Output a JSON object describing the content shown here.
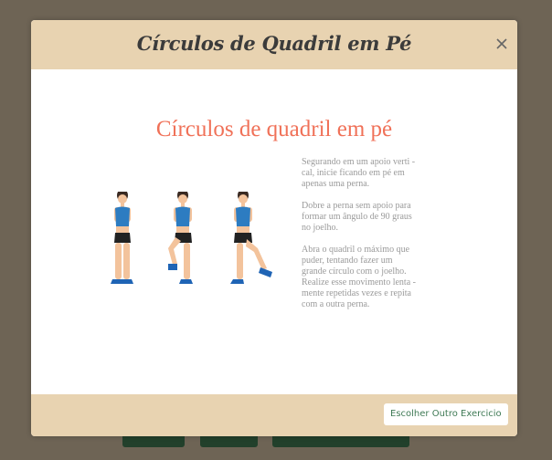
{
  "modal": {
    "title": "Círculos de Quadril em Pé",
    "close_label": "×",
    "close_icon": "close-icon"
  },
  "exercise": {
    "title": "Círculos de quadril em pé",
    "illustration": "woman-hip-circle-exercise-illustration",
    "paragraphs": [
      "Segurando em um apoio verti -\ncal, inicie ficando em pé em\napenas uma perna.",
      "Dobre a perna sem apoio para\nformar um ângulo de 90 graus\nno joelho.",
      "Abra o quadril o máximo que\npuder, tentando fazer um\ngrande círculo com o joelho.\nRealize esse movimento lenta -\nmente repetidas vezes e repita\ncom a outra perna."
    ]
  },
  "footer": {
    "button_label": "Escolher Outro Exercicio"
  },
  "colors": {
    "header_bg": "#e8d3b1",
    "title_accent": "#f07158",
    "overlay": "#6e6455",
    "button_text": "#3f7a55"
  }
}
